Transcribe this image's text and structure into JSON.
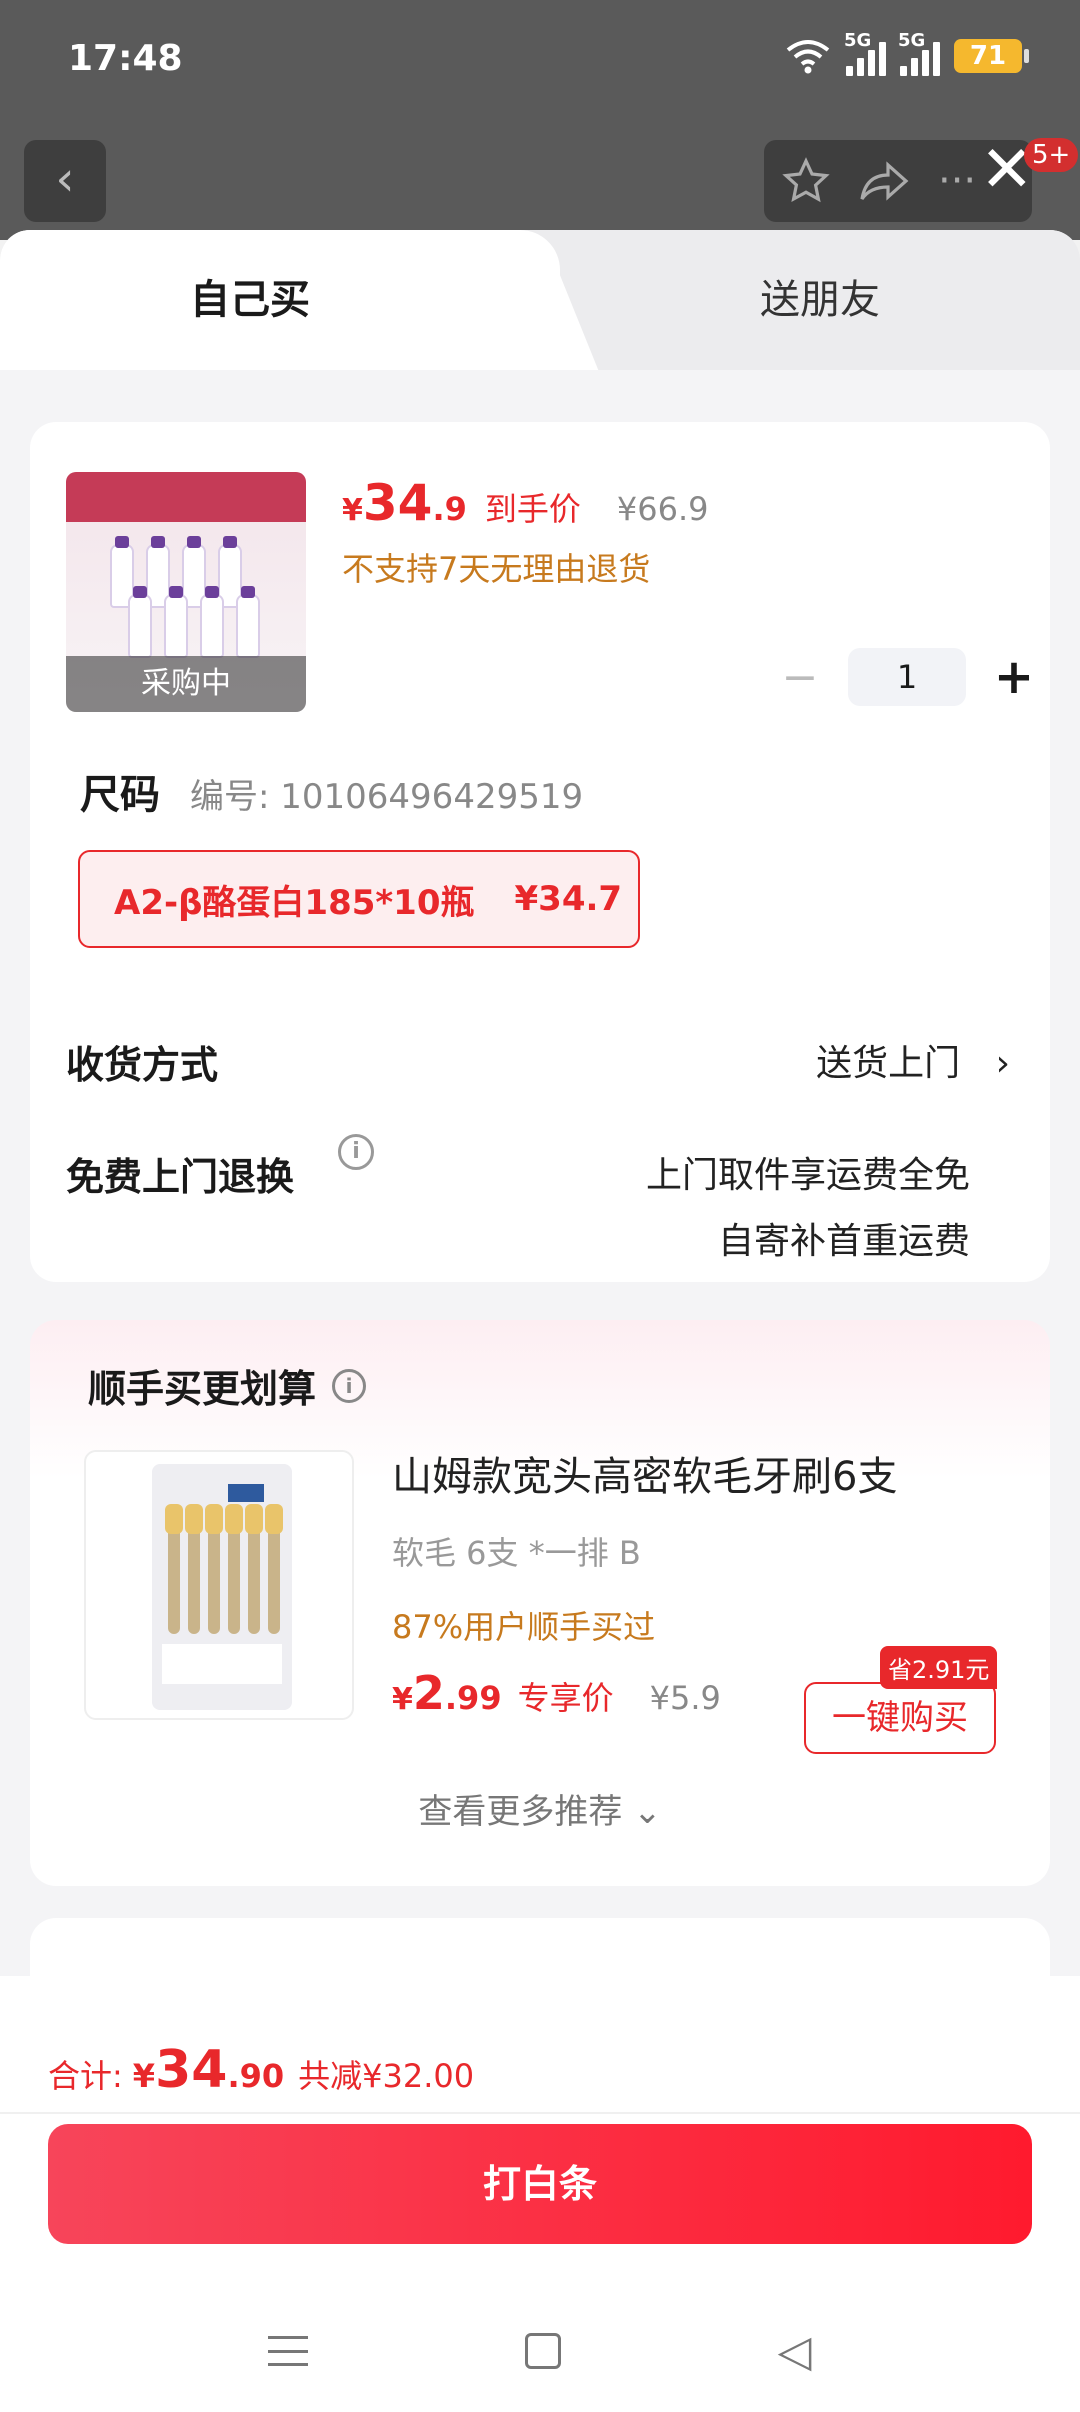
{
  "status_bar": {
    "time": "17:48",
    "battery": "71",
    "network1": "5G",
    "network2": "5G"
  },
  "header": {
    "badge": "5+"
  },
  "tabs": [
    {
      "label": "自己买"
    },
    {
      "label": "送朋友"
    }
  ],
  "product": {
    "image_caption": "采购中",
    "price_currency": "¥",
    "price_int": "34",
    "price_dec": ".9",
    "price_tag": "到手价",
    "orig_price": "¥66.9",
    "no_return": "不支持7天无理由退货",
    "quantity": "1",
    "size_label": "尺码",
    "serial": "编号: 10106496429519",
    "variant_name": "A2-β酪蛋白185*10瓶",
    "variant_price": "¥34.7"
  },
  "delivery": {
    "label": "收货方式",
    "value": "送货上门",
    "arrow": "›"
  },
  "returns": {
    "label": "免费上门退换",
    "value_line1": "上门取件享运费全免",
    "value_line2": "自寄补首重运费"
  },
  "bundle": {
    "title": "顺手买更划算",
    "item_title": "山姆款宽头高密软毛牙刷6支",
    "spec": "软毛 6支 *一排 B",
    "bought": "87%用户顺手买过",
    "price_currency": "¥",
    "price_int": "2",
    "price_dec": ".99",
    "price_tag": "专享价",
    "orig_price": "¥5.9",
    "save_badge": "省2.91元",
    "buy_label": "一键购买",
    "more": "查看更多推荐 ⌄"
  },
  "footer": {
    "total_label": "合计:",
    "total_currency": "¥",
    "total_int": "34",
    "total_dec": ".90",
    "discount": "共减¥32.00",
    "pay_label": "打白条"
  }
}
